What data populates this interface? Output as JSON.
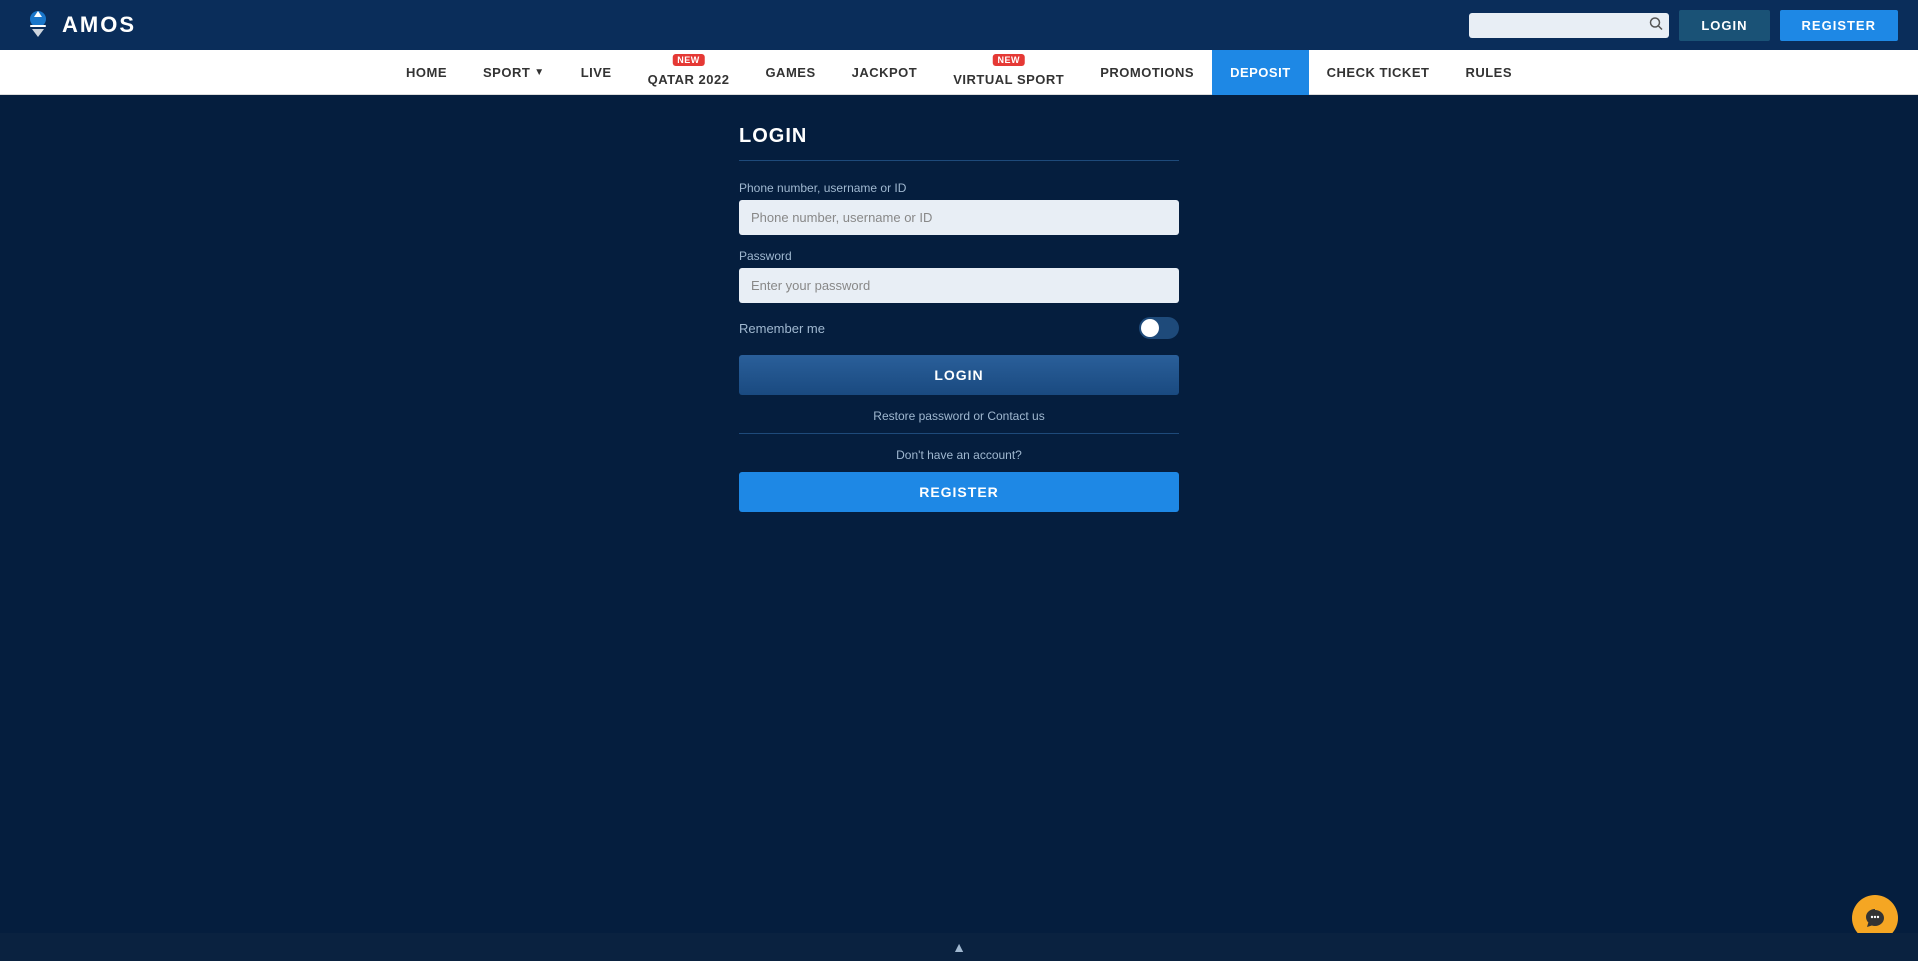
{
  "header": {
    "logo_text": "AMOS",
    "search_placeholder": "",
    "login_button": "LOGIN",
    "register_button": "REGISTER"
  },
  "nav": {
    "items": [
      {
        "label": "HOME",
        "active": false,
        "badge": null
      },
      {
        "label": "SPORT",
        "active": false,
        "badge": null,
        "arrow": true
      },
      {
        "label": "LIVE",
        "active": false,
        "badge": null
      },
      {
        "label": "QATAR 2022",
        "active": false,
        "badge": "NEW"
      },
      {
        "label": "GAMES",
        "active": false,
        "badge": null
      },
      {
        "label": "JACKPOT",
        "active": false,
        "badge": null
      },
      {
        "label": "VIRTUAL SPORT",
        "active": false,
        "badge": "NEW"
      },
      {
        "label": "PROMOTIONS",
        "active": false,
        "badge": null
      },
      {
        "label": "DEPOSIT",
        "active": true,
        "badge": null
      },
      {
        "label": "CHECK TICKET",
        "active": false,
        "badge": null
      },
      {
        "label": "RULES",
        "active": false,
        "badge": null
      }
    ]
  },
  "login_form": {
    "title": "LOGIN",
    "username_label": "Phone number, username or ID",
    "username_placeholder": "Phone number, username or ID",
    "password_label": "Password",
    "password_placeholder": "Enter your password",
    "remember_label": "Remember me",
    "login_button": "LOGIN",
    "restore_link": "Restore password or Contact us",
    "no_account_text": "Don't have an account?",
    "register_button": "REGISTER"
  }
}
